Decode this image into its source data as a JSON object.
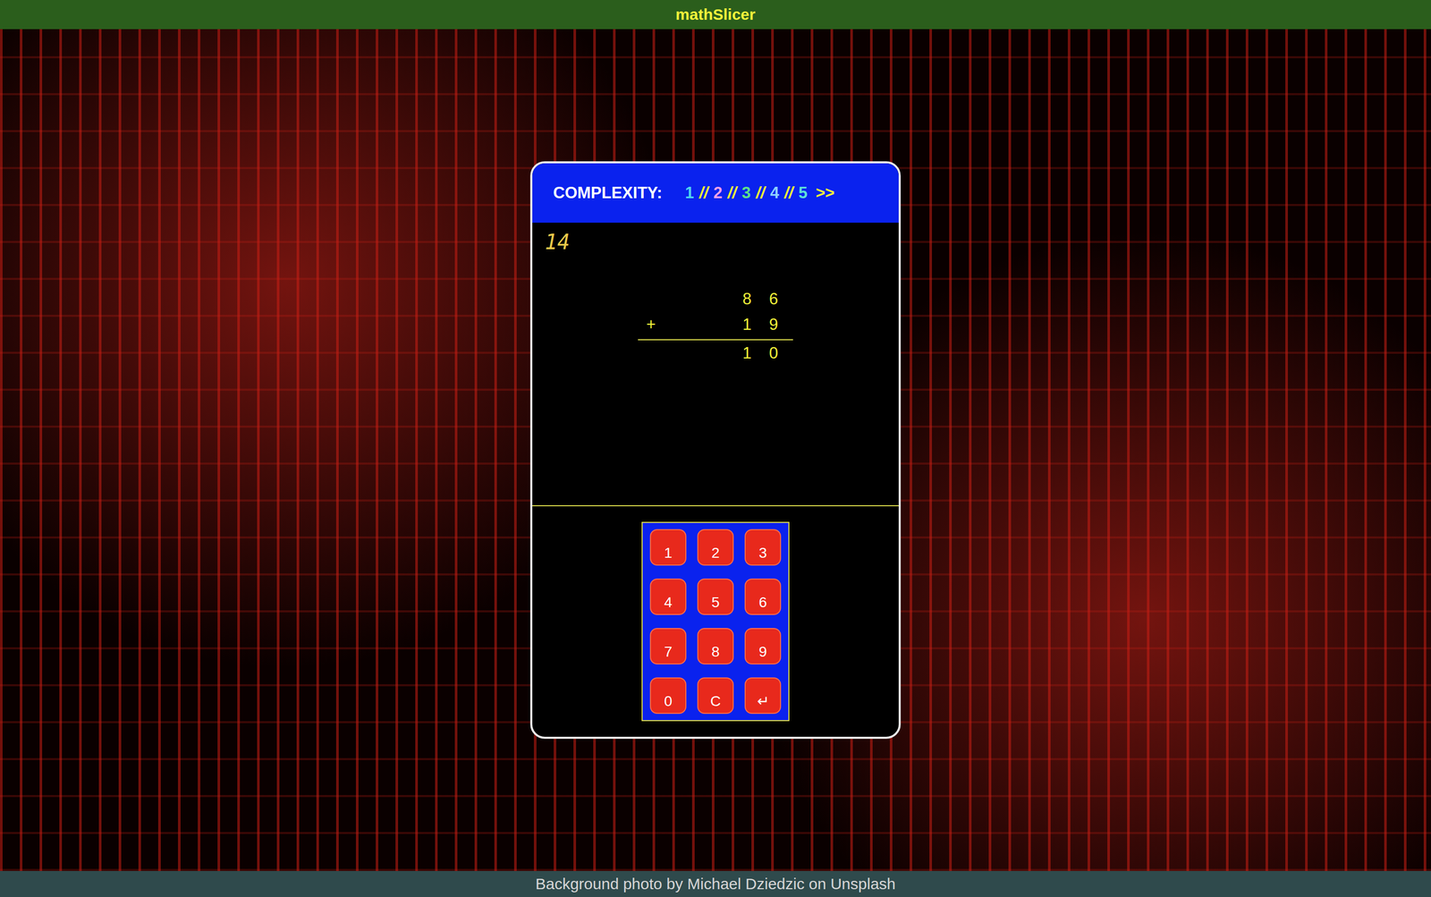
{
  "app": {
    "title": "mathSlicer"
  },
  "complexity": {
    "label": "COMPLEXITY:",
    "separator": "//",
    "next": ">>",
    "levels": [
      {
        "label": "1",
        "color": "#4fd6f0"
      },
      {
        "label": "2",
        "color": "#f0a0e8"
      },
      {
        "label": "3",
        "color": "#5ee08a"
      },
      {
        "label": "4",
        "color": "#8fd0ff"
      },
      {
        "label": "5",
        "color": "#5ee0d8"
      }
    ]
  },
  "score": "14",
  "problem": {
    "operator": "+",
    "operands": [
      [
        "8",
        "6"
      ],
      [
        "1",
        "9"
      ]
    ],
    "answer": [
      "1",
      "0"
    ]
  },
  "keypad": [
    "1",
    "2",
    "3",
    "4",
    "5",
    "6",
    "7",
    "8",
    "9",
    "0",
    "C",
    "↵"
  ],
  "footer": "Background photo by Michael Dziedzic on Unsplash"
}
